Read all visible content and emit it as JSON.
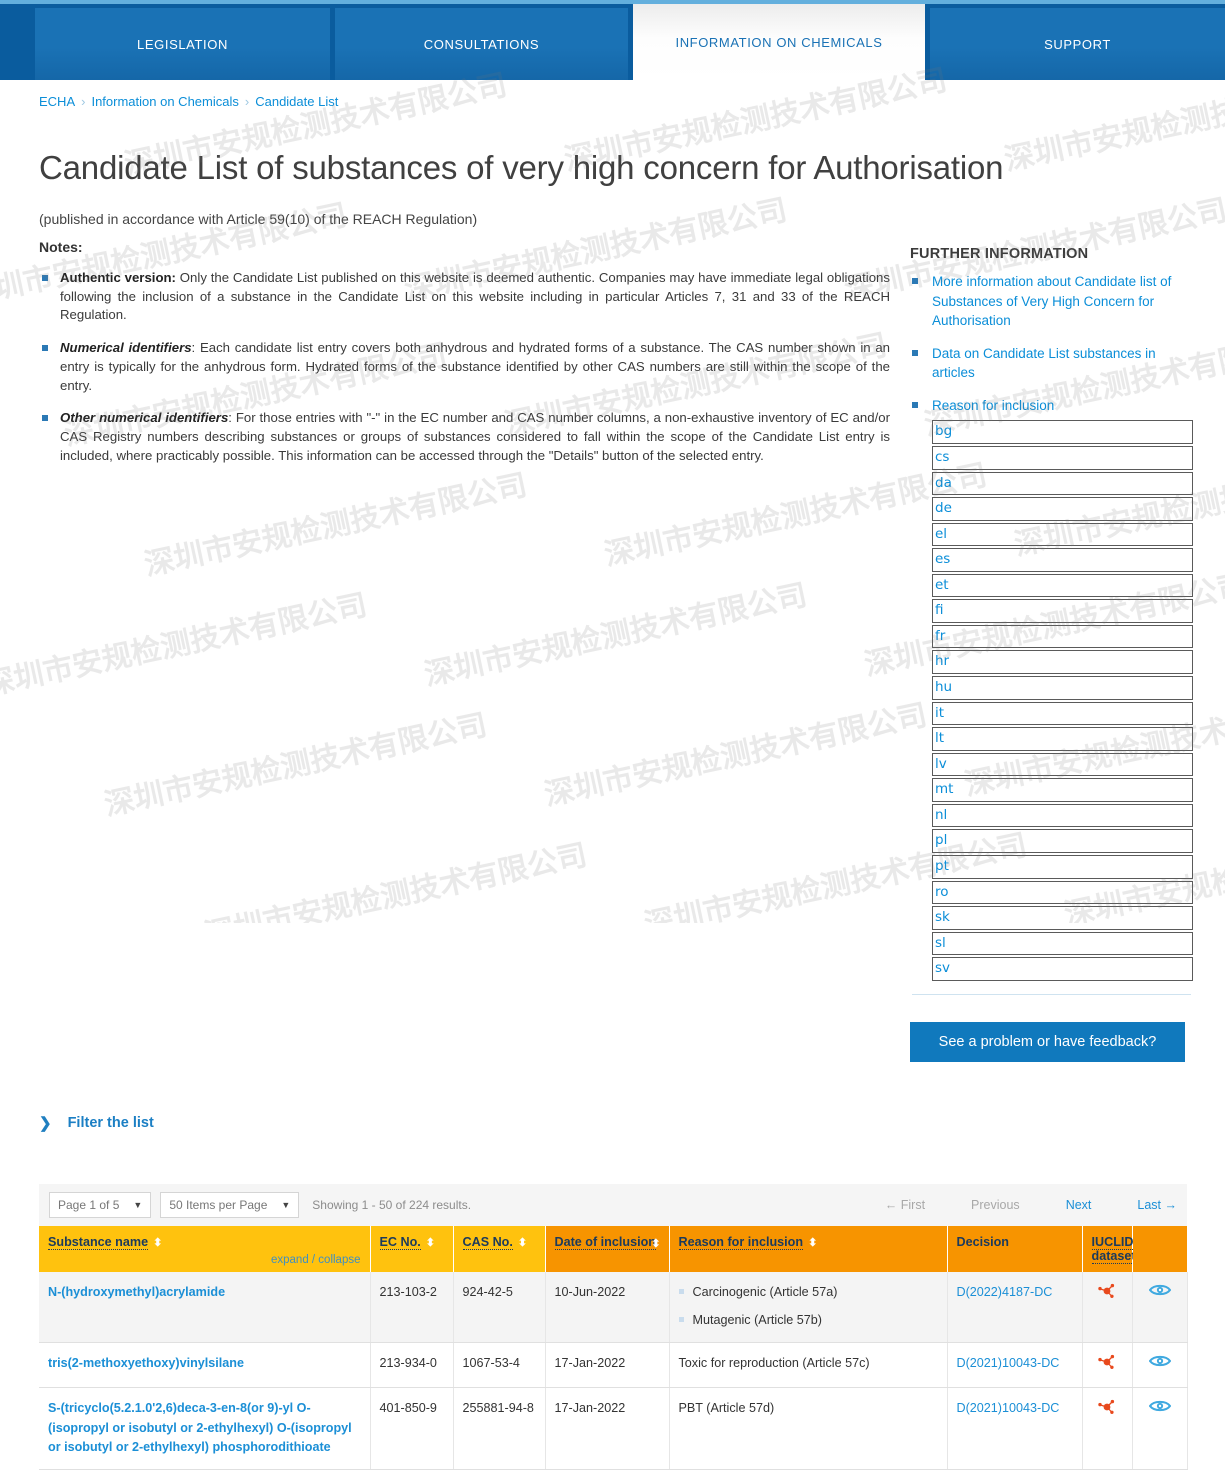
{
  "watermark_text": "深圳市安规检测技术有限公司",
  "nav": {
    "tabs": [
      {
        "label": "LEGISLATION",
        "active": false
      },
      {
        "label": "CONSULTATIONS",
        "active": false
      },
      {
        "label": "INFORMATION ON CHEMICALS",
        "active": true
      },
      {
        "label": "SUPPORT",
        "active": false
      }
    ]
  },
  "breadcrumb": {
    "items": [
      "ECHA",
      "Information on Chemicals",
      "Candidate List"
    ],
    "separator": "›"
  },
  "page": {
    "title": "Candidate List of substances of very high concern for Authorisation",
    "subtitle": "(published in accordance with Article 59(10) of the REACH Regulation)",
    "notes_heading": "Notes:"
  },
  "notes": [
    {
      "lead": "Authentic version:",
      "lead_style": "bold",
      "text": " Only the Candidate List published on this website is deemed authentic. Companies may have immediate legal obligations following the inclusion of a substance in the Candidate List on this website including in particular Articles 7, 31 and 33 of the REACH Regulation."
    },
    {
      "lead": "Numerical identifiers",
      "lead_style": "bold-italic",
      "text": ": Each candidate list entry covers both anhydrous and hydrated forms of a substance. The CAS number shown in an entry is typically for the anhydrous form. Hydrated forms of the substance identified by other CAS numbers are still within the scope of the entry."
    },
    {
      "lead": "Other numerical identifiers",
      "lead_style": "bold-italic",
      "text": ": For those entries with \"-\" in the EC number and CAS number columns, a non-exhaustive inventory of EC and/or CAS Registry numbers describing substances or groups of substances considered to fall within the scope of the Candidate List entry is included, where practicably possible. This information can be accessed through the \"Details\" button of the selected entry."
    }
  ],
  "further_information": {
    "title": "FURTHER INFORMATION",
    "links": [
      "More information about Candidate list of Substances of Very High Concern for Authorisation",
      "Data on Candidate List substances in articles",
      "Reason for inclusion"
    ],
    "languages": [
      "bg",
      "cs",
      "da",
      "de",
      "el",
      "es",
      "et",
      "fi",
      "fr",
      "hr",
      "hu",
      "it",
      "lt",
      "lv",
      "mt",
      "nl",
      "pl",
      "pt",
      "ro",
      "sk",
      "sl",
      "sv"
    ],
    "feedback_button": "See a problem or have feedback?"
  },
  "filter": {
    "label": "Filter the list",
    "chevron": "❯"
  },
  "pagination": {
    "page_select": "Page 1 of 5",
    "items_select": "50 Items per Page",
    "showing": "Showing 1 - 50 of 224 results.",
    "first": "← First",
    "previous": "Previous",
    "next": "Next",
    "last": "Last →",
    "first_enabled": false,
    "previous_enabled": false,
    "next_enabled": true,
    "last_enabled": true
  },
  "table": {
    "columns": [
      {
        "label": "Substance name",
        "sortable": true,
        "dark": false
      },
      {
        "label": "EC No.",
        "sortable": true,
        "dark": false
      },
      {
        "label": "CAS No.",
        "sortable": true,
        "dark": false
      },
      {
        "label": "Date of inclusion",
        "sortable": true,
        "dark": true
      },
      {
        "label": "Reason for inclusion",
        "sortable": true,
        "dark": true
      },
      {
        "label": "Decision",
        "sortable": false,
        "dark": true
      },
      {
        "label": "IUCLID dataset",
        "sortable": false,
        "dark": true
      },
      {
        "label": "",
        "sortable": false,
        "dark": true
      }
    ],
    "expand_collapse": "expand / collapse",
    "rows": [
      {
        "name": "N-(hydroxymethyl)acrylamide",
        "ec_no": "213-103-2",
        "cas_no": "924-42-5",
        "date": "10-Jun-2022",
        "reasons": [
          "Carcinogenic (Article 57a)",
          "Mutagenic (Article 57b)"
        ],
        "decision": "D(2022)4187-DC",
        "iuclid": "molecule-icon",
        "view": "eye-icon"
      },
      {
        "name": "tris(2-methoxyethoxy)vinylsilane",
        "ec_no": "213-934-0",
        "cas_no": "1067-53-4",
        "date": "17-Jan-2022",
        "reasons": [
          "Toxic for reproduction (Article 57c)"
        ],
        "decision": "D(2021)10043-DC",
        "iuclid": "molecule-icon",
        "view": "eye-icon"
      },
      {
        "name": "S-(tricyclo(5.2.1.0'2,6)deca-3-en-8(or 9)-yl O-(isopropyl or isobutyl or 2-ethylhexyl) O-(isopropyl or isobutyl or 2-ethylhexyl) phosphorodithioate",
        "ec_no": "401-850-9",
        "cas_no": "255881-94-8",
        "date": "17-Jan-2022",
        "reasons": [
          "PBT (Article 57d)"
        ],
        "decision": "D(2021)10043-DC",
        "iuclid": "molecule-icon",
        "view": "eye-icon"
      }
    ]
  },
  "colors": {
    "nav_blue": "#0a5c9e",
    "tab_blue": "#1a72b5",
    "link_blue": "#0b8ed8",
    "header_yellow": "#ffc20e",
    "header_orange": "#f79400",
    "molecule_red": "#e8491d",
    "eye_blue": "#3fa9e0"
  }
}
